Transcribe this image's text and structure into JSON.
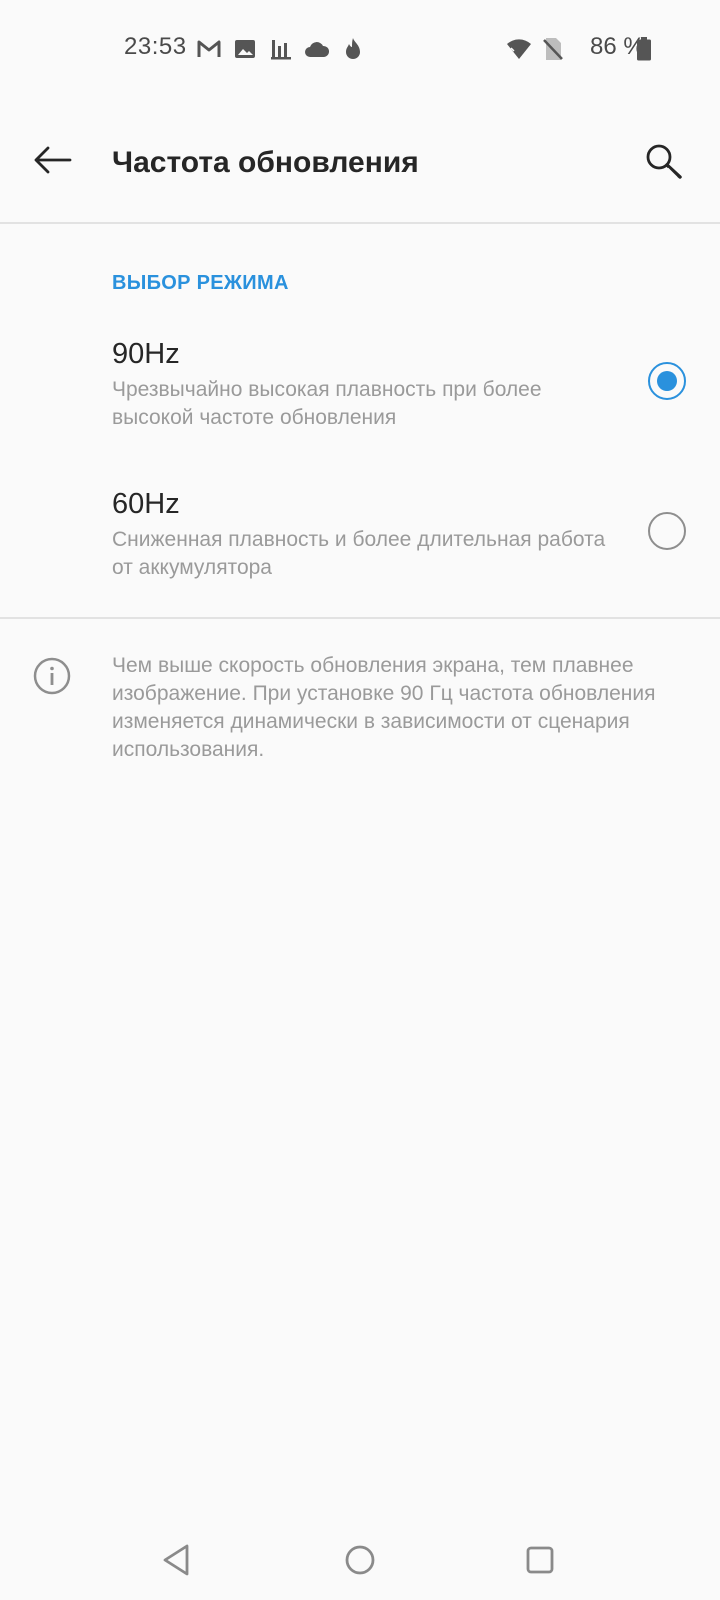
{
  "status_bar": {
    "time": "23:53",
    "notification_icons": [
      "gmail-icon",
      "photo-icon",
      "stats-icon",
      "cloud-icon",
      "flame-icon"
    ],
    "battery_percent": "86 %"
  },
  "app_bar": {
    "title": "Частота обновления"
  },
  "section": {
    "header": "ВЫБОР РЕЖИМА"
  },
  "options": [
    {
      "title": "90Hz",
      "description": "Чрезвычайно высокая плавность при более высокой частоте обновления",
      "selected": true
    },
    {
      "title": "60Hz",
      "description": "Сниженная плавность и более длительная работа от аккумулятора",
      "selected": false
    }
  ],
  "info": {
    "text": "Чем выше скорость обновления экрана, тем плавнее изображение. При установке 90 Гц частота обновления изменяется динамически в зависимости от сценария использования."
  },
  "colors": {
    "accent": "#2a91dd",
    "background": "#fafafa"
  }
}
